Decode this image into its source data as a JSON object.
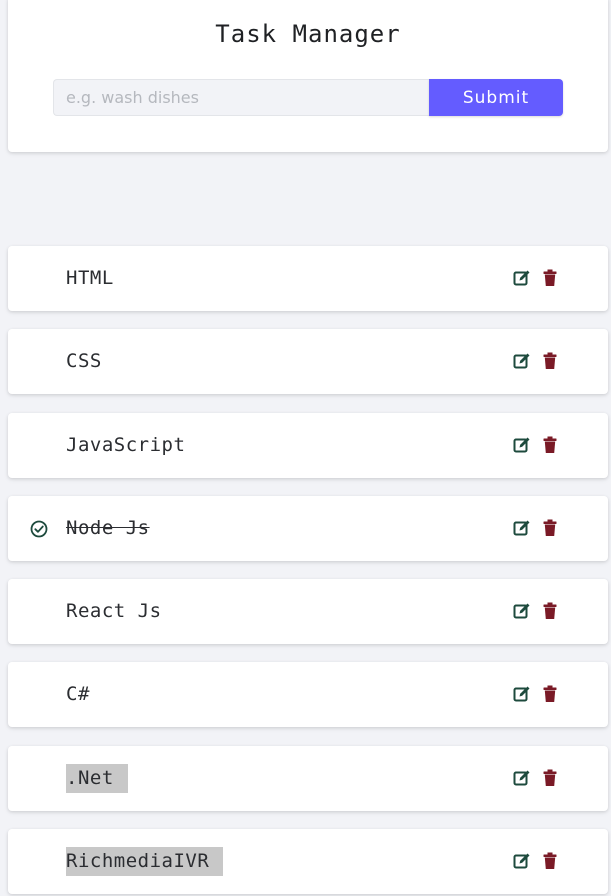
{
  "header": {
    "title": "Task Manager"
  },
  "form": {
    "input_value": "",
    "input_placeholder": "e.g. wash dishes",
    "submit_label": "Submit"
  },
  "colors": {
    "accent": "#645cff",
    "edit_icon": "#1d4a3d",
    "delete_icon": "#7a1a26",
    "background": "#f2f3f7"
  },
  "icons": {
    "check": "check-circle-icon",
    "edit": "edit-icon",
    "delete": "trash-icon"
  },
  "tasks": [
    {
      "name": "HTML",
      "completed": false,
      "highlighted": false
    },
    {
      "name": "CSS",
      "completed": false,
      "highlighted": false
    },
    {
      "name": "JavaScript",
      "completed": false,
      "highlighted": false
    },
    {
      "name": "Node Js",
      "completed": true,
      "highlighted": false
    },
    {
      "name": "React Js",
      "completed": false,
      "highlighted": false
    },
    {
      "name": "C#",
      "completed": false,
      "highlighted": false
    },
    {
      "name": ".Net",
      "completed": false,
      "highlighted": true
    },
    {
      "name": "RichmediaIVR",
      "completed": false,
      "highlighted": true
    }
  ]
}
